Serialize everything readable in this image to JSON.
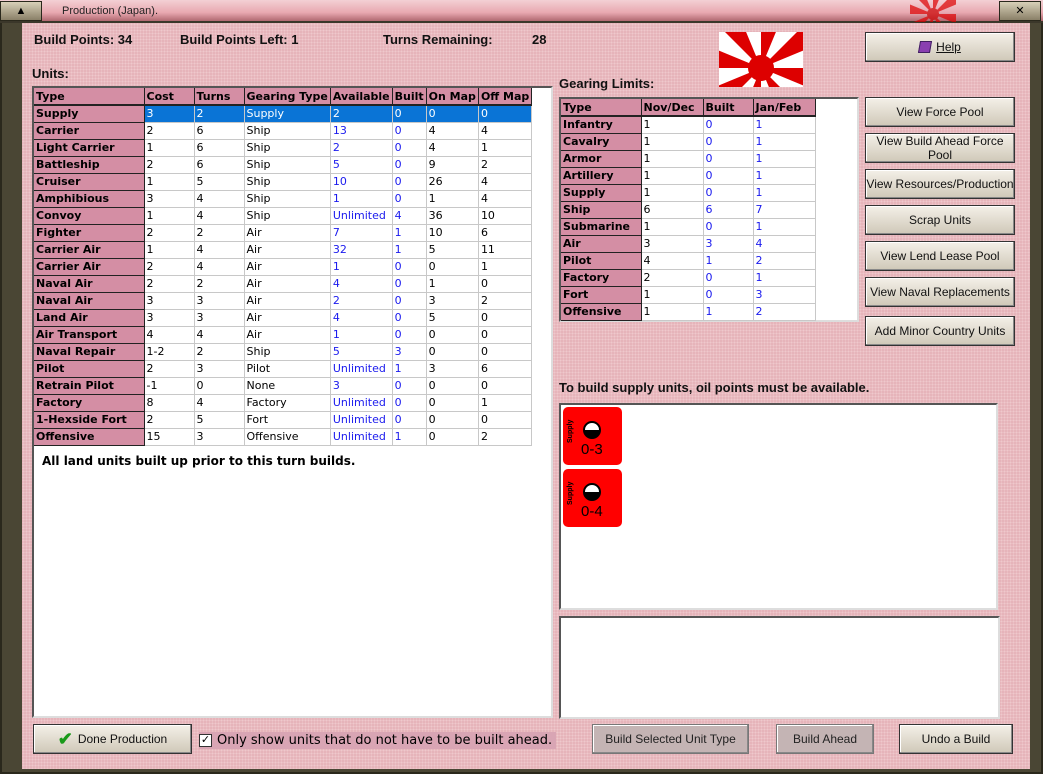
{
  "window": {
    "title": "Production (Japan)."
  },
  "header": {
    "build_points": "Build Points: 34",
    "build_points_left": "Build Points Left:  1",
    "turns_remaining_label": "Turns Remaining:",
    "turns_remaining": "28"
  },
  "units": {
    "label": "Units:",
    "columns": [
      "Type",
      "Cost",
      "Turns",
      "Gearing Type",
      "Available",
      "Built",
      "On Map",
      "Off Map"
    ],
    "rows": [
      [
        "Supply",
        "3",
        "2",
        "Supply",
        "2",
        "0",
        "0",
        "0"
      ],
      [
        "Carrier",
        "2",
        "6",
        "Ship",
        "13",
        "0",
        "4",
        "4"
      ],
      [
        "Light Carrier",
        "1",
        "6",
        "Ship",
        "2",
        "0",
        "4",
        "1"
      ],
      [
        "Battleship",
        "2",
        "6",
        "Ship",
        "5",
        "0",
        "9",
        "2"
      ],
      [
        "Cruiser",
        "1",
        "5",
        "Ship",
        "10",
        "0",
        "26",
        "4"
      ],
      [
        "Amphibious",
        "3",
        "4",
        "Ship",
        "1",
        "0",
        "1",
        "4"
      ],
      [
        "Convoy",
        "1",
        "4",
        "Ship",
        "Unlimited",
        "4",
        "36",
        "10"
      ],
      [
        "Fighter",
        "2",
        "2",
        "Air",
        "7",
        "1",
        "10",
        "6"
      ],
      [
        "Carrier Air",
        "1",
        "4",
        "Air",
        "32",
        "1",
        "5",
        "11"
      ],
      [
        "Carrier Air",
        "2",
        "4",
        "Air",
        "1",
        "0",
        "0",
        "1"
      ],
      [
        "Naval Air",
        "2",
        "2",
        "Air",
        "4",
        "0",
        "1",
        "0"
      ],
      [
        "Naval Air",
        "3",
        "3",
        "Air",
        "2",
        "0",
        "3",
        "2"
      ],
      [
        "Land Air",
        "3",
        "3",
        "Air",
        "4",
        "0",
        "5",
        "0"
      ],
      [
        "Air Transport",
        "4",
        "4",
        "Air",
        "1",
        "0",
        "0",
        "0"
      ],
      [
        "Naval Repair",
        "1-2",
        "2",
        "Ship",
        "5",
        "3",
        "0",
        "0"
      ],
      [
        "Pilot",
        "2",
        "3",
        "Pilot",
        "Unlimited",
        "1",
        "3",
        "6"
      ],
      [
        "Retrain Pilot",
        "-1",
        "0",
        "None",
        "3",
        "0",
        "0",
        "0"
      ],
      [
        "Factory",
        "8",
        "4",
        "Factory",
        "Unlimited",
        "0",
        "0",
        "1"
      ],
      [
        "1-Hexside Fort",
        "2",
        "5",
        "Fort",
        "Unlimited",
        "0",
        "0",
        "0"
      ],
      [
        "Offensive",
        "15",
        "3",
        "Offensive",
        "Unlimited",
        "1",
        "0",
        "2"
      ]
    ],
    "selected_row": "Supply",
    "note": "All land units built up prior to this turn builds."
  },
  "gearing": {
    "label": "Gearing Limits:",
    "columns": [
      "Type",
      "Nov/Dec",
      "Built",
      "Jan/Feb"
    ],
    "rows": [
      [
        "Infantry",
        "1",
        "0",
        "1"
      ],
      [
        "Cavalry",
        "1",
        "0",
        "1"
      ],
      [
        "Armor",
        "1",
        "0",
        "1"
      ],
      [
        "Artillery",
        "1",
        "0",
        "1"
      ],
      [
        "Supply",
        "1",
        "0",
        "1"
      ],
      [
        "Ship",
        "6",
        "6",
        "7"
      ],
      [
        "Submarine",
        "1",
        "0",
        "1"
      ],
      [
        "Air",
        "3",
        "3",
        "4"
      ],
      [
        "Pilot",
        "4",
        "1",
        "2"
      ],
      [
        "Factory",
        "2",
        "0",
        "1"
      ],
      [
        "Fort",
        "1",
        "0",
        "3"
      ],
      [
        "Offensive",
        "1",
        "1",
        "2"
      ]
    ]
  },
  "side_buttons": [
    {
      "label": "Help",
      "icon": "help-book-icon"
    },
    {
      "label": "View Force Pool"
    },
    {
      "label": "View Build Ahead Force Pool"
    },
    {
      "label": "View Resources/Production"
    },
    {
      "label": "Scrap Units"
    },
    {
      "label": "View Lend Lease Pool"
    },
    {
      "label": "View Naval Replacements"
    },
    {
      "label": "Add Minor Country Units"
    }
  ],
  "supply_message": "To build supply units, oil points must be available.",
  "counters": [
    {
      "type": "Supply",
      "value": "0-3"
    },
    {
      "type": "Supply",
      "value": "0-4"
    }
  ],
  "bottom": {
    "done": "Done Production",
    "checkbox_label": "Only show units that do not have to be built ahead.",
    "checkbox_checked": true,
    "build_selected": "Build Selected Unit Type",
    "build_ahead": "Build Ahead",
    "undo": "Undo a Build"
  },
  "colors": {
    "header_pink": "#d48ea4",
    "selected": "#0a74d6",
    "link_blue": "#1a1aee",
    "counter_red": "#ff0000"
  }
}
